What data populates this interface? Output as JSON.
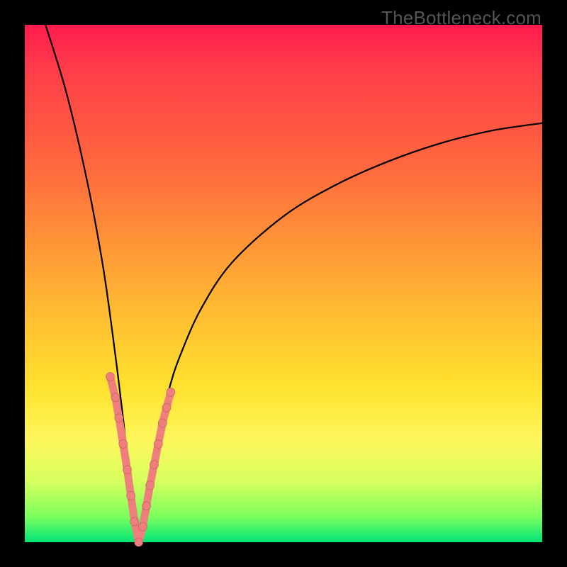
{
  "watermark": "TheBottleneck.com",
  "colors": {
    "frame": "#000000",
    "gradient_top": "#ff1a4d",
    "gradient_mid1": "#ff6a3d",
    "gradient_mid2": "#ffe22e",
    "gradient_bot": "#00e676",
    "curve": "#000000",
    "nodes_fill": "#ef7f7d",
    "nodes_stroke": "#b85a58"
  },
  "chart_data": {
    "type": "line",
    "title": "",
    "xlabel": "",
    "ylabel": "",
    "xlim": [
      0,
      100
    ],
    "ylim": [
      0,
      100
    ],
    "grid": false,
    "legend": false,
    "note": "V-shaped bottleneck curve; y≈100 at x small, dips to y≈0 near x≈22, rises toward y≈80 at x=100. Values estimated from pixels (no axes shown).",
    "series": [
      {
        "name": "bottleneck-curve",
        "x": [
          4,
          8,
          12,
          15,
          17,
          19,
          20,
          21,
          22,
          23,
          24,
          26,
          28,
          30,
          34,
          40,
          50,
          60,
          70,
          80,
          90,
          100
        ],
        "y": [
          100,
          87,
          70,
          54,
          40,
          24,
          14,
          6,
          0,
          4,
          12,
          22,
          30,
          36,
          45,
          54,
          63,
          69,
          73.5,
          77,
          79.5,
          81
        ]
      }
    ],
    "nodes_on_curve": {
      "name": "highlighted-points",
      "note": "Pink capsule/dots clustered near the valley of the V.",
      "x": [
        16.5,
        17.5,
        18.2,
        19.0,
        19.8,
        20.5,
        21.2,
        22.0,
        22.8,
        23.5,
        24.2,
        25.0,
        25.8,
        26.6,
        27.4,
        28.2
      ],
      "y": [
        32,
        28,
        24,
        19,
        14,
        9,
        4,
        0,
        3,
        7,
        11,
        15,
        19,
        23,
        26,
        29
      ]
    }
  }
}
